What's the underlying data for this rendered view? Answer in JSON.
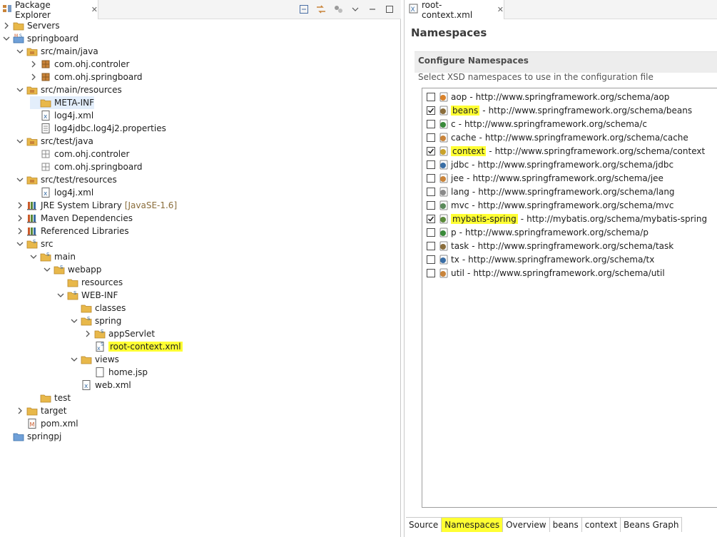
{
  "package_explorer": {
    "tab_label": "Package Explorer",
    "toolbar": [
      "collapse-all-icon",
      "link-with-editor-icon",
      "focus-icon",
      "view-menu-icon",
      "minimize-icon",
      "maximize-icon"
    ],
    "tree": [
      {
        "label": "Servers",
        "icon": "folder-icon",
        "depth": 0,
        "twisty": "collapsed"
      },
      {
        "label": "springboard",
        "icon": "maven-project-icon",
        "depth": 0,
        "twisty": "expanded"
      },
      {
        "label": "src/main/java",
        "icon": "source-folder-icon",
        "depth": 1,
        "twisty": "expanded"
      },
      {
        "label": "com.ohj.controler",
        "icon": "package-icon",
        "depth": 2,
        "twisty": "collapsed"
      },
      {
        "label": "com.ohj.springboard",
        "icon": "package-icon",
        "depth": 2,
        "twisty": "collapsed"
      },
      {
        "label": "src/main/resources",
        "icon": "source-folder-icon",
        "depth": 1,
        "twisty": "expanded"
      },
      {
        "label": "META-INF",
        "icon": "folder-icon",
        "depth": 2,
        "twisty": "none",
        "selected": true
      },
      {
        "label": "log4j.xml",
        "icon": "xml-file-icon",
        "depth": 2,
        "twisty": "none"
      },
      {
        "label": "log4jdbc.log4j2.properties",
        "icon": "properties-file-icon",
        "depth": 2,
        "twisty": "none"
      },
      {
        "label": "src/test/java",
        "icon": "source-folder-icon",
        "depth": 1,
        "twisty": "expanded"
      },
      {
        "label": "com.ohj.controler",
        "icon": "empty-package-icon",
        "depth": 2,
        "twisty": "none"
      },
      {
        "label": "com.ohj.springboard",
        "icon": "empty-package-icon",
        "depth": 2,
        "twisty": "none"
      },
      {
        "label": "src/test/resources",
        "icon": "source-folder-icon",
        "depth": 1,
        "twisty": "expanded"
      },
      {
        "label": "log4j.xml",
        "icon": "xml-file-icon",
        "depth": 2,
        "twisty": "none"
      },
      {
        "label": "JRE System Library",
        "decoration": "[JavaSE-1.6]",
        "icon": "library-icon",
        "depth": 1,
        "twisty": "collapsed"
      },
      {
        "label": "Maven Dependencies",
        "icon": "library-icon",
        "depth": 1,
        "twisty": "collapsed"
      },
      {
        "label": "Referenced Libraries",
        "icon": "library-icon",
        "depth": 1,
        "twisty": "collapsed"
      },
      {
        "label": "src",
        "icon": "spring-folder-icon",
        "depth": 1,
        "twisty": "expanded"
      },
      {
        "label": "main",
        "icon": "spring-folder-icon",
        "depth": 2,
        "twisty": "expanded"
      },
      {
        "label": "webapp",
        "icon": "spring-folder-icon",
        "depth": 3,
        "twisty": "expanded"
      },
      {
        "label": "resources",
        "icon": "folder-icon",
        "depth": 4,
        "twisty": "none"
      },
      {
        "label": "WEB-INF",
        "icon": "spring-folder-icon",
        "depth": 4,
        "twisty": "expanded"
      },
      {
        "label": "classes",
        "icon": "folder-icon",
        "depth": 5,
        "twisty": "none"
      },
      {
        "label": "spring",
        "icon": "spring-folder-icon",
        "depth": 5,
        "twisty": "expanded"
      },
      {
        "label": "appServlet",
        "icon": "spring-folder-icon",
        "depth": 6,
        "twisty": "collapsed"
      },
      {
        "label": "root-context.xml",
        "icon": "spring-xml-icon",
        "depth": 6,
        "twisty": "none",
        "highlighted": true
      },
      {
        "label": "views",
        "icon": "folder-icon",
        "depth": 5,
        "twisty": "expanded"
      },
      {
        "label": "home.jsp",
        "icon": "jsp-file-icon",
        "depth": 6,
        "twisty": "none"
      },
      {
        "label": "web.xml",
        "icon": "xml-file-icon",
        "depth": 5,
        "twisty": "none"
      },
      {
        "label": "test",
        "icon": "folder-icon",
        "depth": 2,
        "twisty": "none"
      },
      {
        "label": "target",
        "icon": "folder-icon",
        "depth": 1,
        "twisty": "collapsed"
      },
      {
        "label": "pom.xml",
        "icon": "maven-pom-icon",
        "depth": 1,
        "twisty": "none"
      },
      {
        "label": "springpj",
        "icon": "project-folder-icon",
        "depth": 0,
        "twisty": "none"
      }
    ]
  },
  "editor": {
    "tab_label": "root-context.xml",
    "page_title": "Namespaces",
    "section_title": "Configure Namespaces",
    "section_desc": "Select XSD namespaces to use in the configuration file",
    "namespaces": [
      {
        "prefix": "aop",
        "uri": "http://www.springframework.org/schema/aop",
        "checked": false,
        "highlighted": false,
        "icon": "aop-icon"
      },
      {
        "prefix": "beans",
        "uri": "http://www.springframework.org/schema/beans",
        "checked": true,
        "highlighted": true,
        "icon": "beans-icon"
      },
      {
        "prefix": "c",
        "uri": "http://www.springframework.org/schema/c",
        "checked": false,
        "highlighted": false,
        "icon": "c-namespace-icon"
      },
      {
        "prefix": "cache",
        "uri": "http://www.springframework.org/schema/cache",
        "checked": false,
        "highlighted": false,
        "icon": "cache-icon"
      },
      {
        "prefix": "context",
        "uri": "http://www.springframework.org/schema/context",
        "checked": true,
        "highlighted": true,
        "icon": "context-icon"
      },
      {
        "prefix": "jdbc",
        "uri": "http://www.springframework.org/schema/jdbc",
        "checked": false,
        "highlighted": false,
        "icon": "jdbc-icon"
      },
      {
        "prefix": "jee",
        "uri": "http://www.springframework.org/schema/jee",
        "checked": false,
        "highlighted": false,
        "icon": "jee-icon"
      },
      {
        "prefix": "lang",
        "uri": "http://www.springframework.org/schema/lang",
        "checked": false,
        "highlighted": false,
        "icon": "lang-icon"
      },
      {
        "prefix": "mvc",
        "uri": "http://www.springframework.org/schema/mvc",
        "checked": false,
        "highlighted": false,
        "icon": "mvc-icon"
      },
      {
        "prefix": "mybatis-spring",
        "uri": "http://mybatis.org/schema/mybatis-spring",
        "checked": true,
        "highlighted": true,
        "icon": "mybatis-icon"
      },
      {
        "prefix": "p",
        "uri": "http://www.springframework.org/schema/p",
        "checked": false,
        "highlighted": false,
        "icon": "p-namespace-icon"
      },
      {
        "prefix": "task",
        "uri": "http://www.springframework.org/schema/task",
        "checked": false,
        "highlighted": false,
        "icon": "task-icon"
      },
      {
        "prefix": "tx",
        "uri": "http://www.springframework.org/schema/tx",
        "checked": false,
        "highlighted": false,
        "icon": "tx-icon"
      },
      {
        "prefix": "util",
        "uri": "http://www.springframework.org/schema/util",
        "checked": false,
        "highlighted": false,
        "icon": "util-icon"
      }
    ],
    "separator": "-",
    "bottom_tabs": [
      {
        "label": "Source",
        "active": false
      },
      {
        "label": "Namespaces",
        "active": true
      },
      {
        "label": "Overview",
        "active": false
      },
      {
        "label": "beans",
        "active": false
      },
      {
        "label": "context",
        "active": false
      },
      {
        "label": "Beans Graph",
        "active": false
      }
    ]
  },
  "colors": {
    "highlight": "#ffff33",
    "folder": "#e8b84a",
    "package": "#c9843a",
    "selection": "#e3eefb"
  }
}
